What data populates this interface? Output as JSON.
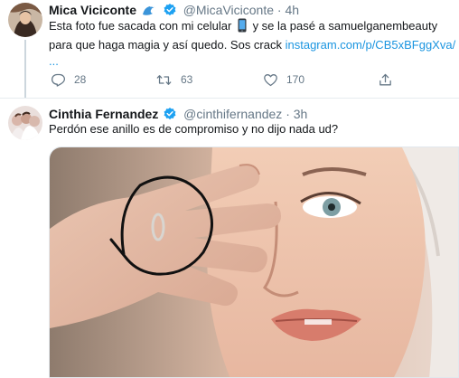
{
  "tweets": [
    {
      "author_name": "Mica Viciconte",
      "handle": "@MicaViciconte",
      "separator": "·",
      "time": "4h",
      "text_line1_before_emoji": "Esta foto fue sacada con mi celular ",
      "text_line1_after_emoji": " y se la pasé a samuelganembeauty",
      "text_line2_before_link": "para que haga magia y así quedo. Sos crack ",
      "link": "instagram.com/p/CB5xBFggXva/",
      "text_line3": "...",
      "icons": [
        "wave-emoji",
        "verified-badge",
        "phone-emoji"
      ],
      "actions": {
        "reply_count": "28",
        "retweet_count": "63",
        "like_count": "170"
      }
    },
    {
      "author_name": "Cinthia Fernandez",
      "handle": "@cinthifernandez",
      "separator": "·",
      "time": "3h",
      "text": "Perdón ese anillo es de compromiso y no dijo nada ud?",
      "icons": [
        "verified-badge"
      ]
    }
  ],
  "colors": {
    "link": "#1b95e0",
    "verified": "#1da1f2",
    "secondary_text": "#657786",
    "divider": "#e6ecf0"
  }
}
